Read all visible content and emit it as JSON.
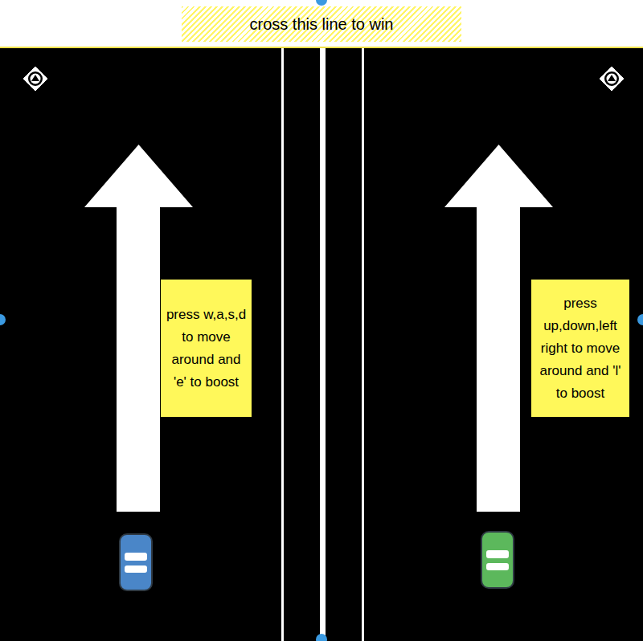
{
  "banner": {
    "text": "cross this line to win"
  },
  "players": [
    {
      "instructions": "press w,a,s,d to move around and 'e' to boost",
      "color": "#4a86c8"
    },
    {
      "instructions": "press up,down,left right to move around and 'l' to boost",
      "color": "#5cb85c"
    }
  ]
}
